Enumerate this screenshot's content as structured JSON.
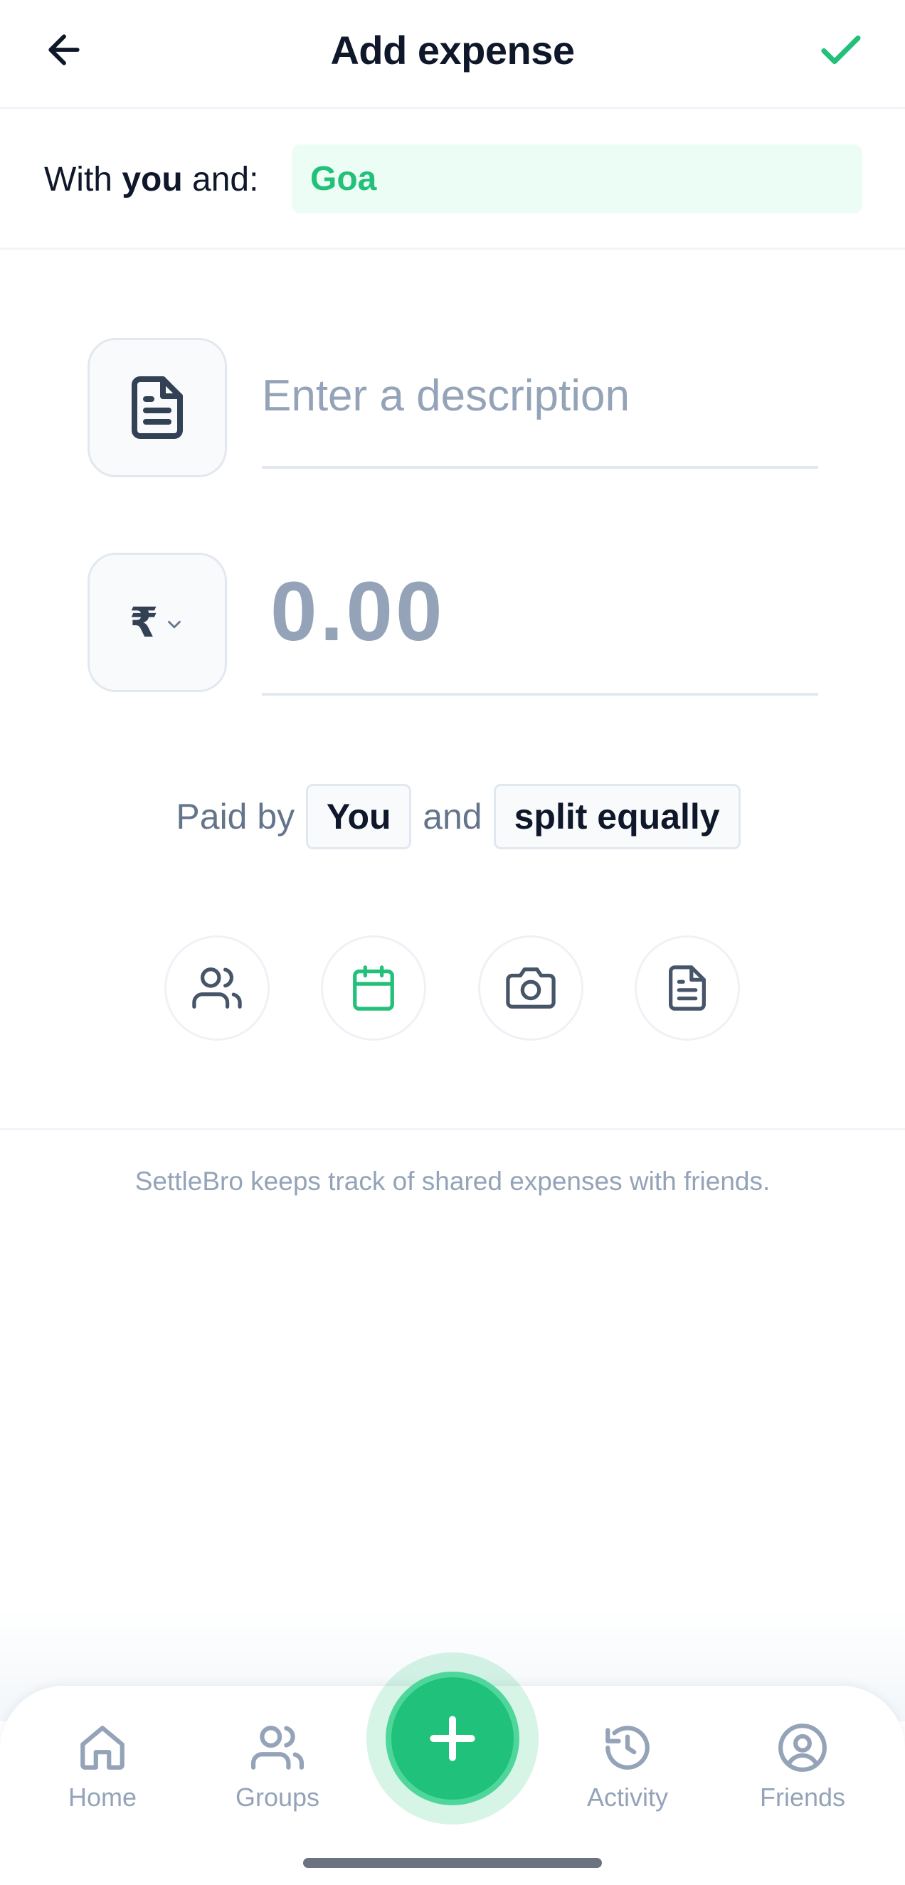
{
  "header": {
    "title": "Add expense"
  },
  "with_row": {
    "prefix": "With ",
    "bold_word": "you",
    "suffix": " and:",
    "group_name": "Goa"
  },
  "form": {
    "description_placeholder": "Enter a description",
    "currency_symbol": "₹",
    "amount_placeholder": "0.00"
  },
  "paid_row": {
    "paid_by_text": "Paid by",
    "payer": "You",
    "and_text": "and",
    "split_mode": "split equally"
  },
  "actions": [
    {
      "icon": "users-icon"
    },
    {
      "icon": "calendar-icon"
    },
    {
      "icon": "camera-icon"
    },
    {
      "icon": "notes-icon"
    }
  ],
  "footer_text": "SettleBro keeps track of shared expenses with friends.",
  "bottom_nav": {
    "items": [
      {
        "label": "Home",
        "icon": "home-icon"
      },
      {
        "label": "Groups",
        "icon": "groups-icon"
      },
      {
        "label": "Activity",
        "icon": "history-icon"
      },
      {
        "label": "Friends",
        "icon": "user-circle-icon"
      }
    ],
    "fab_icon": "plus-icon"
  },
  "colors": {
    "accent": "#22c079",
    "fab": "#1fc17b",
    "text_primary": "#0f172a",
    "text_muted": "#94a3b8"
  }
}
